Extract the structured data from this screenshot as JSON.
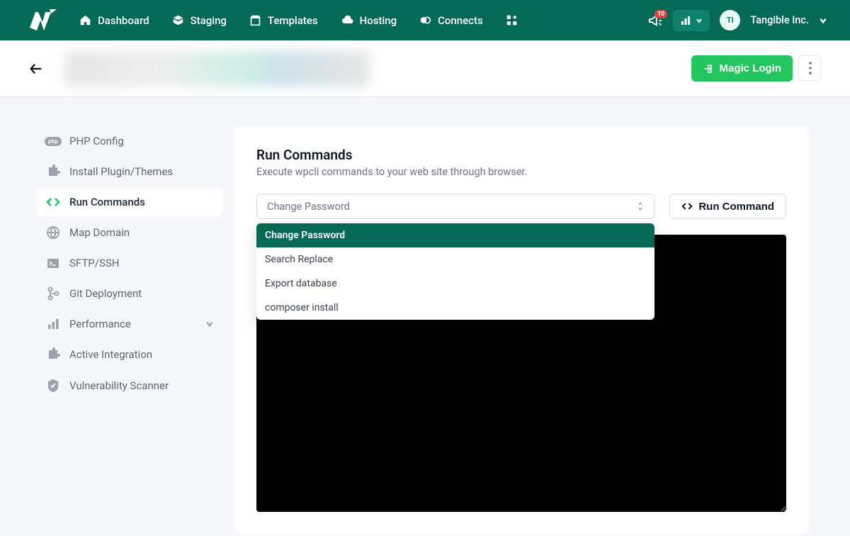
{
  "topnav": {
    "items": [
      {
        "label": "Dashboard"
      },
      {
        "label": "Staging"
      },
      {
        "label": "Templates"
      },
      {
        "label": "Hosting"
      },
      {
        "label": "Connects"
      }
    ],
    "notif_count": "10",
    "avatar_initials": "TI",
    "org_name": "Tangible Inc."
  },
  "subheader": {
    "magic_login": "Magic Login"
  },
  "sidebar": {
    "items": [
      {
        "label": "PHP Config"
      },
      {
        "label": "Install Plugin/Themes"
      },
      {
        "label": "Run Commands"
      },
      {
        "label": "Map Domain"
      },
      {
        "label": "SFTP/SSH"
      },
      {
        "label": "Git Deployment"
      },
      {
        "label": "Performance"
      },
      {
        "label": "Active Integration"
      },
      {
        "label": "Vulnerability Scanner"
      }
    ]
  },
  "content": {
    "title": "Run Commands",
    "subtitle": "Execute wpcli commands to your web site through browser.",
    "selected": "Change Password",
    "options": [
      "Change Password",
      "Search Replace",
      "Export database",
      "composer install"
    ],
    "run_btn": "Run Command"
  }
}
